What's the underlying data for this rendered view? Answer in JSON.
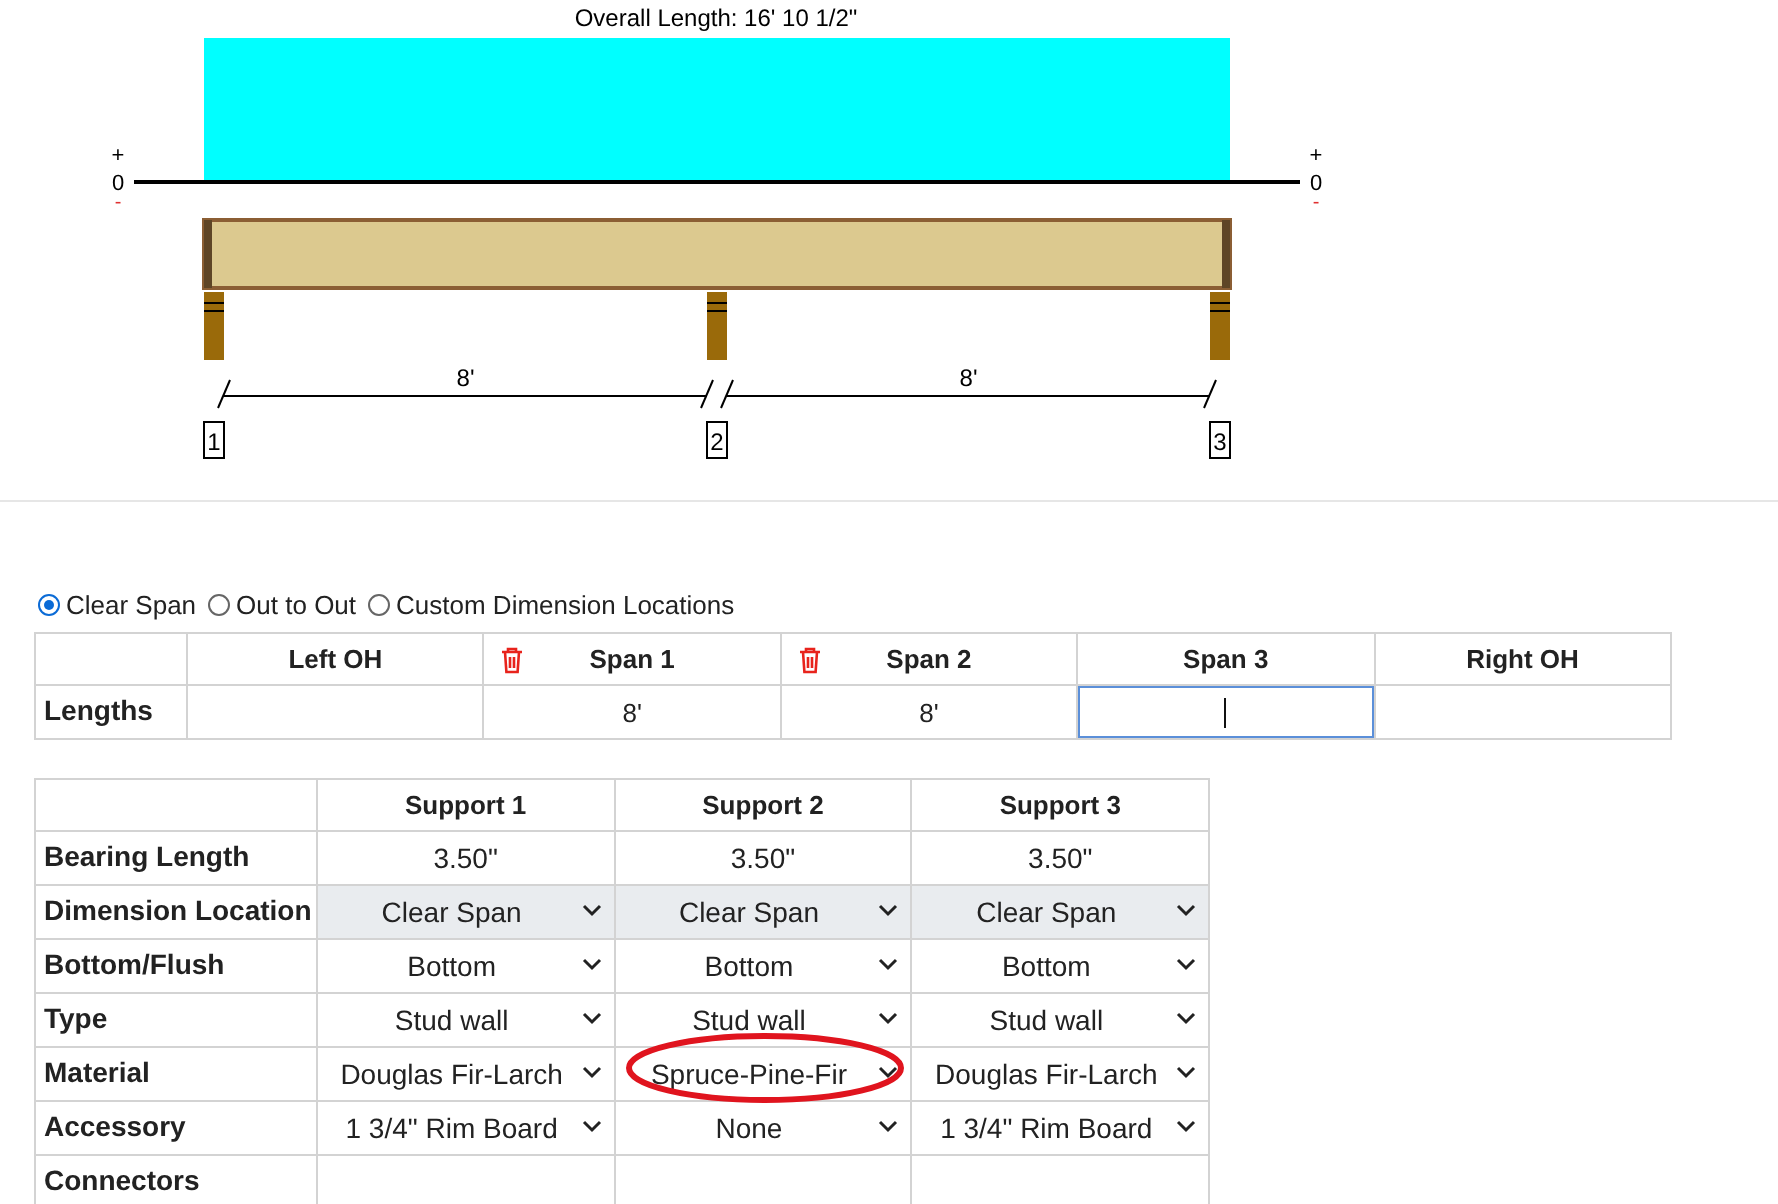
{
  "diagram": {
    "title": "Overall Length: 16' 10 1/2\"",
    "left_scale": {
      "plus": "+",
      "zero": "0",
      "minus": "-"
    },
    "right_scale": {
      "plus": "+",
      "zero": "0",
      "minus": "-"
    },
    "spans": [
      {
        "label": "8'"
      },
      {
        "label": "8'"
      }
    ],
    "supports": [
      {
        "label": "1"
      },
      {
        "label": "2"
      },
      {
        "label": "3"
      }
    ]
  },
  "dimension_mode": [
    {
      "label": "Clear Span",
      "selected": true
    },
    {
      "label": "Out to Out",
      "selected": false
    },
    {
      "label": "Custom Dimension Locations",
      "selected": false
    }
  ],
  "spans_table": {
    "columns": [
      {
        "label": "Left OH",
        "deletable": false
      },
      {
        "label": "Span 1",
        "deletable": true
      },
      {
        "label": "Span 2",
        "deletable": true
      },
      {
        "label": "Span 3",
        "deletable": false
      },
      {
        "label": "Right OH",
        "deletable": false
      }
    ],
    "row_label": "Lengths",
    "cells": [
      {
        "focused": false
      },
      {
        "value": "8'",
        "focused": false
      },
      {
        "value": "8'",
        "focused": false
      },
      {
        "focused": true
      },
      {
        "focused": false
      }
    ]
  },
  "supports_table": {
    "columns": [
      "Support 1",
      "Support 2",
      "Support 3"
    ],
    "rows": [
      {
        "label": "Bearing Length",
        "kind": "text",
        "shaded": false,
        "cells": [
          {
            "value": "3.50\""
          },
          {
            "value": "3.50\""
          },
          {
            "value": "3.50\""
          }
        ]
      },
      {
        "label": "Dimension Location",
        "kind": "select",
        "shaded": true,
        "cells": [
          {
            "value": "Clear Span",
            "circled": false
          },
          {
            "value": "Clear Span",
            "circled": false
          },
          {
            "value": "Clear Span",
            "circled": false
          }
        ]
      },
      {
        "label": "Bottom/Flush",
        "kind": "select",
        "shaded": false,
        "cells": [
          {
            "value": "Bottom",
            "circled": false
          },
          {
            "value": "Bottom",
            "circled": false
          },
          {
            "value": "Bottom",
            "circled": false
          }
        ]
      },
      {
        "label": "Type",
        "kind": "select",
        "shaded": false,
        "cells": [
          {
            "value": "Stud wall",
            "circled": false
          },
          {
            "value": "Stud wall",
            "circled": false
          },
          {
            "value": "Stud wall",
            "circled": false
          }
        ]
      },
      {
        "label": "Material",
        "kind": "select",
        "shaded": false,
        "cells": [
          {
            "value": "Douglas Fir-Larch",
            "circled": false
          },
          {
            "value": "Spruce-Pine-Fir",
            "circled": true
          },
          {
            "value": "Douglas Fir-Larch",
            "circled": false
          }
        ]
      },
      {
        "label": "Accessory",
        "kind": "select",
        "shaded": false,
        "cells": [
          {
            "value": "1 3/4\" Rim Board",
            "circled": false
          },
          {
            "value": "None",
            "circled": false
          },
          {
            "value": "1 3/4\" Rim Board",
            "circled": false
          }
        ]
      },
      {
        "label": "Connectors",
        "kind": "empty",
        "shaded": false
      }
    ]
  }
}
